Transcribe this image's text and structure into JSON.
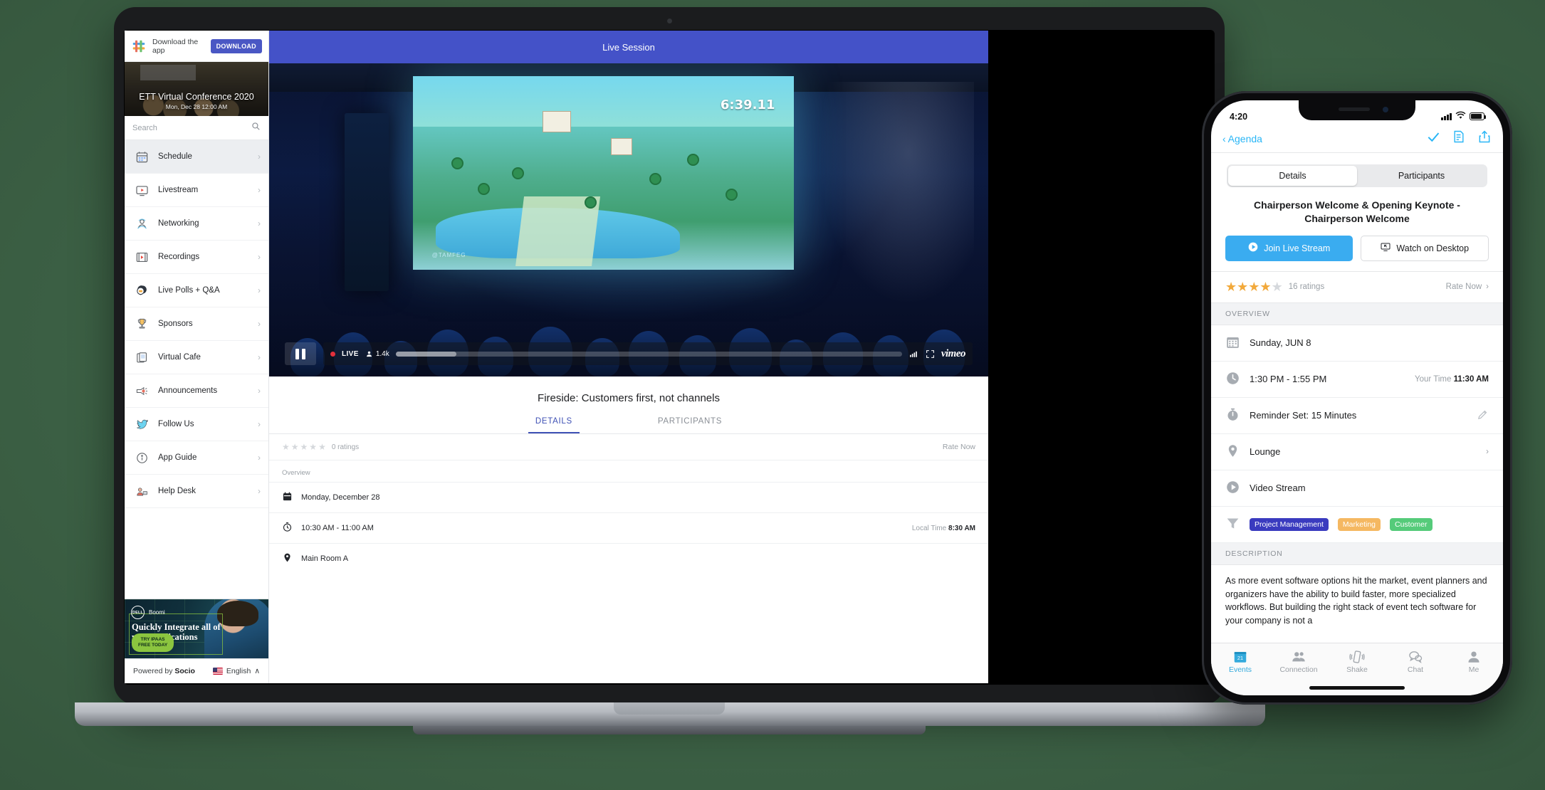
{
  "laptop": {
    "download_bar": {
      "text": "Download the app",
      "button": "DOWNLOAD",
      "logo_icon": "socio-logo-icon"
    },
    "hero": {
      "title": "ETT Virtual Conference 2020",
      "subtitle": "Mon, Dec 28 12:00 AM"
    },
    "search": {
      "placeholder": "Search",
      "icon": "search-icon"
    },
    "nav_items": [
      {
        "label": "Schedule",
        "icon": "calendar-icon",
        "active": true
      },
      {
        "label": "Livestream",
        "icon": "monitor-play-icon",
        "active": false
      },
      {
        "label": "Networking",
        "icon": "people-icon",
        "active": false
      },
      {
        "label": "Recordings",
        "icon": "film-icon",
        "active": false
      },
      {
        "label": "Live Polls + Q&A",
        "icon": "chat-poll-icon",
        "active": false
      },
      {
        "label": "Sponsors",
        "icon": "trophy-icon",
        "active": false
      },
      {
        "label": "Virtual Cafe",
        "icon": "cards-icon",
        "active": false
      },
      {
        "label": "Announcements",
        "icon": "megaphone-icon",
        "active": false
      },
      {
        "label": "Follow Us",
        "icon": "twitter-icon",
        "active": false
      },
      {
        "label": "App Guide",
        "icon": "info-icon",
        "active": false
      },
      {
        "label": "Help Desk",
        "icon": "help-desk-icon",
        "active": false
      }
    ],
    "ad": {
      "brand": "DELL",
      "sub_brand": "Boomi",
      "headline": "Quickly Integrate all of your applications",
      "cta_line1": "TRY IPAAS",
      "cta_line2": "FREE TODAY"
    },
    "footer": {
      "powered_prefix": "Powered by ",
      "powered_brand": "Socio",
      "language": "English",
      "chevron": "∧"
    },
    "topbar": {
      "title": "Live Session"
    },
    "player": {
      "live_label": "LIVE",
      "viewers": "1.4k",
      "provider": "vimeo",
      "timer_overlay": "6:39.11",
      "stream_badge": "@TAMFEG",
      "play_state": "paused",
      "icons": [
        "pause-icon",
        "signal-icon",
        "fullscreen-icon",
        "vimeo-logo-icon"
      ]
    },
    "session": {
      "title": "Fireside: Customers first, not channels",
      "tabs": [
        {
          "label": "DETAILS",
          "active": true
        },
        {
          "label": "PARTICIPANTS",
          "active": false
        }
      ],
      "rating": {
        "filled": 0,
        "total": 5,
        "count_text": "0 ratings",
        "rate_now": "Rate Now"
      },
      "overview_label": "Overview",
      "rows": [
        {
          "icon": "calendar-icon",
          "text": "Monday, December 28",
          "right_label": "",
          "right_value": ""
        },
        {
          "icon": "clock-icon",
          "text": "10:30 AM - 11:00 AM",
          "right_label": "Local Time ",
          "right_value": "8:30 AM"
        },
        {
          "icon": "location-icon",
          "text": "Main Room A",
          "right_label": "",
          "right_value": ""
        }
      ]
    }
  },
  "phone": {
    "status": {
      "time": "4:20",
      "cellular_icon": "signal-bars-icon",
      "wifi_icon": "wifi-icon",
      "battery_icon": "battery-icon"
    },
    "navbar": {
      "back": "Agenda",
      "back_icon": "chevron-left-icon",
      "actions": [
        "check-icon",
        "notes-icon",
        "share-icon"
      ]
    },
    "segmented": [
      {
        "label": "Details",
        "active": true
      },
      {
        "label": "Participants",
        "active": false
      }
    ],
    "title": "Chairperson Welcome & Opening Keynote - Chairperson Welcome",
    "buttons": [
      {
        "label": "Join Live Stream",
        "icon": "play-circle-icon",
        "style": "primary"
      },
      {
        "label": "Watch on Desktop",
        "icon": "desktop-icon",
        "style": "secondary"
      }
    ],
    "rating": {
      "filled": 4,
      "total": 5,
      "count_text": "16 ratings",
      "rate_now": "Rate Now",
      "chevron": "›"
    },
    "overview_label": "OVERVIEW",
    "rows": [
      {
        "icon": "calendar-icon",
        "text": "Sunday, JUN 8",
        "right_label": "",
        "right_value": "",
        "accessory": ""
      },
      {
        "icon": "clock-icon",
        "text": "1:30 PM - 1:55 PM",
        "right_label": "Your Time ",
        "right_value": "11:30 AM",
        "accessory": ""
      },
      {
        "icon": "stopwatch-icon",
        "text": "Reminder Set: 15 Minutes",
        "right_label": "",
        "right_value": "",
        "accessory": "pencil-icon"
      },
      {
        "icon": "location-icon",
        "text": "Lounge",
        "right_label": "",
        "right_value": "",
        "accessory": "chevron-right-icon"
      },
      {
        "icon": "play-circle-icon",
        "text": "Video Stream",
        "right_label": "",
        "right_value": "",
        "accessory": ""
      }
    ],
    "tags_icon": "filter-icon",
    "tags": [
      {
        "label": "Project Management",
        "color": "#3a3bbf"
      },
      {
        "label": "Marketing",
        "color": "#f5b861"
      },
      {
        "label": "Customer",
        "color": "#55cb7a"
      }
    ],
    "description_label": "DESCRIPTION",
    "description": "As more event software options hit the market, event planners and organizers have the ability to build faster, more specialized workflows. But building the right stack of event tech software for your company is not a",
    "tabbar": [
      {
        "label": "Events",
        "icon": "calendar-21-icon",
        "active": true
      },
      {
        "label": "Connection",
        "icon": "people-icon",
        "active": false
      },
      {
        "label": "Shake",
        "icon": "shake-phone-icon",
        "active": false
      },
      {
        "label": "Chat",
        "icon": "chat-bubbles-icon",
        "active": false
      },
      {
        "label": "Me",
        "icon": "person-icon",
        "active": false
      }
    ]
  },
  "colors": {
    "accent_blue": "#4452c8",
    "ios_blue": "#29b6f6",
    "star_gold": "#f2a93b",
    "live_red": "#e2303c"
  }
}
